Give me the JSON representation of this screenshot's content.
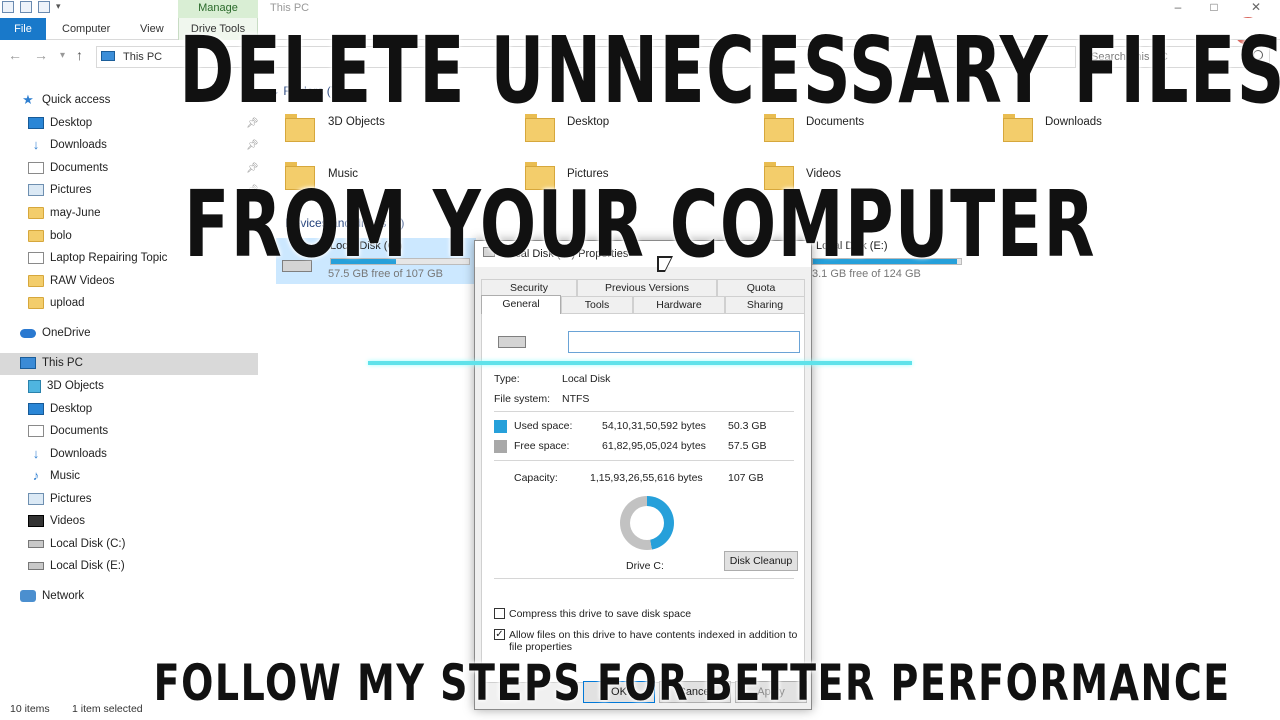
{
  "window": {
    "title": "This PC",
    "manage_tab": "Manage",
    "help_icon": "?"
  },
  "ribbon": {
    "file": "File",
    "computer": "Computer",
    "view": "View",
    "drive_tools": "Drive Tools"
  },
  "address": {
    "path": "This PC",
    "search_placeholder": "Search This PC"
  },
  "nav": {
    "quick_access": "Quick access",
    "quick_items": [
      "Desktop",
      "Downloads",
      "Documents",
      "Pictures",
      "may-June",
      "bolo",
      "Laptop Repairing Topic",
      "RAW Videos",
      "upload"
    ],
    "onedrive": "OneDrive",
    "this_pc": "This PC",
    "pc_items": [
      "3D Objects",
      "Desktop",
      "Documents",
      "Downloads",
      "Music",
      "Pictures",
      "Videos",
      "Local Disk (C:)",
      "Local Disk (E:)"
    ],
    "network": "Network"
  },
  "content": {
    "folders_header": "Folders (7)",
    "folders": [
      "3D Objects",
      "Desktop",
      "Documents",
      "Downloads",
      "Music",
      "Pictures",
      "Videos"
    ],
    "devices_header": "Devices and drives (2)",
    "drive_c_name": "Local Disk (C:)",
    "drive_c_free": "57.5 GB free of 107 GB",
    "drive_c_used_fraction": 0.47,
    "drive_e_name": "Local Disk (E:)",
    "drive_e_free": "3.1 GB free of 124 GB",
    "drive_e_used_fraction": 0.97
  },
  "dialog": {
    "title": "Local Disk (C:) Properties",
    "tabs_row1": [
      "Security",
      "Previous Versions",
      "Quota"
    ],
    "tabs_row2": [
      "General",
      "Tools",
      "Hardware",
      "Sharing"
    ],
    "drive_label_value": "",
    "type_label": "Type:",
    "type_value": "Local Disk",
    "fs_label": "File system:",
    "fs_value": "NTFS",
    "used_label": "Used space:",
    "used_bytes": "54,10,31,50,592 bytes",
    "used_gb": "50.3 GB",
    "free_label": "Free space:",
    "free_bytes": "61,82,95,05,024 bytes",
    "free_gb": "57.5 GB",
    "capacity_label": "Capacity:",
    "capacity_bytes": "1,15,93,26,55,616 bytes",
    "capacity_gb": "107 GB",
    "drive_caption": "Drive C:",
    "disk_cleanup": "Disk Cleanup",
    "compress_label": "Compress this drive to save disk space",
    "compress_checked": false,
    "index_label": "Allow files on this drive to have contents indexed in addition to file properties",
    "index_checked": true,
    "ok": "OK",
    "cancel": "Cancel",
    "apply": "Apply",
    "used_color": "#26a0da",
    "free_color": "#a8a8a8"
  },
  "status": {
    "items": "10 items",
    "selected": "1 item selected"
  },
  "overlay": {
    "headline1": "DELETE UNNECESSARY FILES",
    "headline2": "FROM YOUR COMPUTER",
    "subline": "FOLLOW MY STEPS FOR BETTER PERFORMANCE",
    "accent_line_color": "#5fe2ea"
  }
}
